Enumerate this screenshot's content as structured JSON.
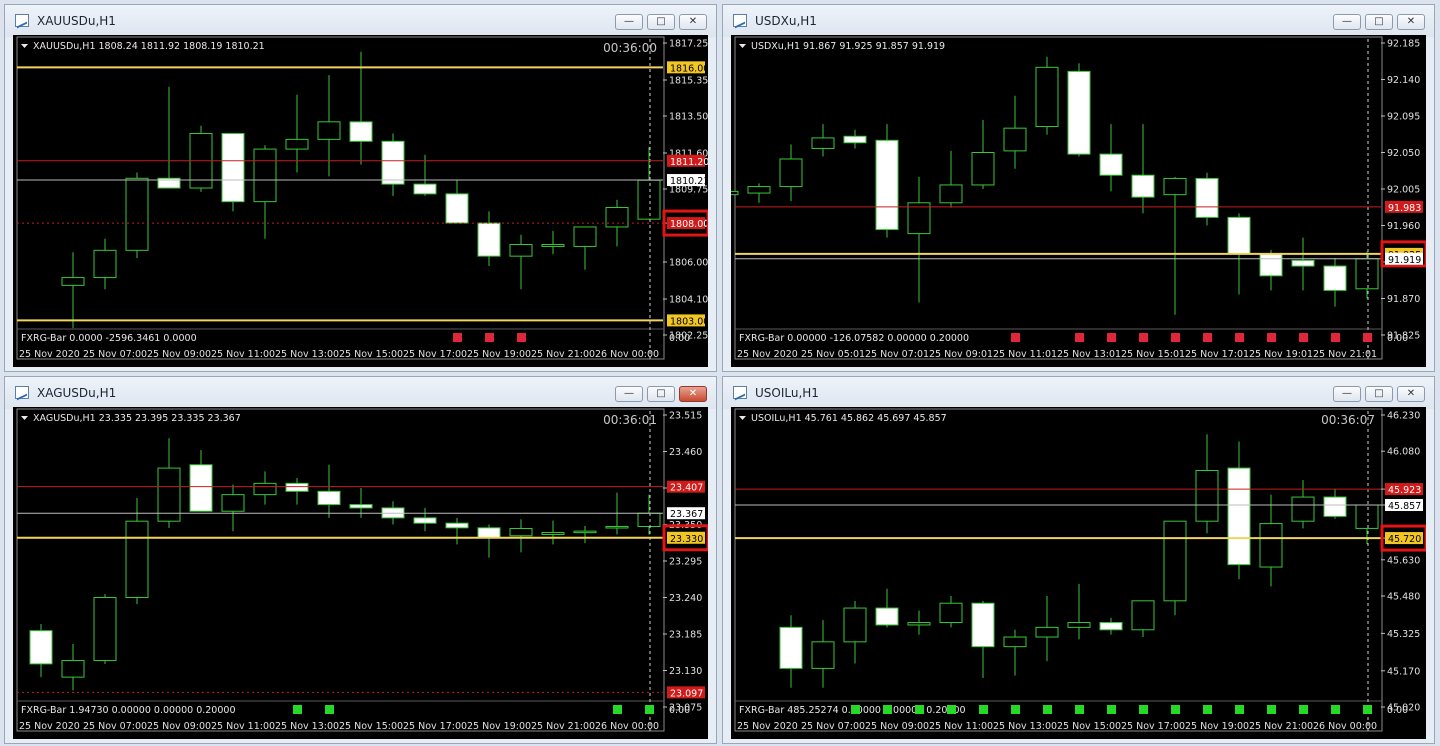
{
  "windows": [
    {
      "title": "XAUUSDu,H1",
      "header": "XAUUSDu,H1  1808.24 1811.92 1808.19 1810.21",
      "timer": "00:36:00",
      "price_labels": [
        "1817.25",
        "1815.35",
        "1813.50",
        "1811.60",
        "1809.75",
        "1808.00",
        "1806.00",
        "1804.10",
        "1802.25"
      ],
      "levels": [
        {
          "value": 1816.0,
          "label": "1816.00",
          "style": "yellow"
        },
        {
          "value": 1811.2,
          "label": "1811.20",
          "style": "red"
        },
        {
          "value": 1810.21,
          "label": "1810.21",
          "style": "white"
        },
        {
          "value": 1808.0,
          "label": "1808.00",
          "style": "red-dashed",
          "highlight": true
        },
        {
          "value": 1803.0,
          "label": "1803.00",
          "style": "yellow"
        }
      ],
      "time_labels": [
        "25 Nov 2020",
        "25 Nov 07:00",
        "25 Nov 09:00",
        "25 Nov 11:00",
        "25 Nov 13:00",
        "25 Nov 15:00",
        "25 Nov 17:00",
        "25 Nov 19:00",
        "25 Nov 21:00",
        "26 Nov 00:00"
      ],
      "indicator": "FXRG-Bar 0.0000 -2596.3461 0.0000",
      "indicator_axis": "0.00",
      "marker_color": "#e0263c",
      "marker_slots": [
        12,
        13,
        14
      ],
      "nbars": 19
    },
    {
      "title": "USDXu,H1",
      "header": "USDXu,H1  91.867 91.925 91.857 91.919",
      "timer": "",
      "price_labels": [
        "92.185",
        "92.140",
        "92.095",
        "92.050",
        "92.005",
        "91.960",
        "91.915",
        "91.870",
        "91.825"
      ],
      "levels": [
        {
          "value": 91.983,
          "label": "91.983",
          "style": "red"
        },
        {
          "value": 91.925,
          "label": "91.925",
          "style": "yellow",
          "highlight": true
        },
        {
          "value": 91.919,
          "label": "91.919",
          "style": "white"
        }
      ],
      "time_labels": [
        "25 Nov 2020",
        "25 Nov 05:01",
        "25 Nov 07:01",
        "25 Nov 09:01",
        "25 Nov 11:01",
        "25 Nov 13:01",
        "25 Nov 15:01",
        "25 Nov 17:01",
        "25 Nov 19:01",
        "25 Nov 21:01"
      ],
      "indicator": "FXRG-Bar 0.00000 -126.07582 0.00000 0.20000",
      "indicator_axis": "0.00",
      "marker_color": "#e0263c",
      "marker_slots": [
        7,
        9,
        10,
        11,
        12,
        13,
        14,
        15,
        16,
        17,
        18
      ],
      "nbars": 19
    },
    {
      "title": "XAGUSDu,H1",
      "header": "XAGUSDu,H1  23.335 23.395 23.335 23.367",
      "timer": "00:36:01",
      "price_labels": [
        "23.515",
        "23.460",
        "23.405",
        "23.350",
        "23.295",
        "23.240",
        "23.185",
        "23.130",
        "23.075"
      ],
      "levels": [
        {
          "value": 23.407,
          "label": "23.407",
          "style": "red"
        },
        {
          "value": 23.367,
          "label": "23.367",
          "style": "white"
        },
        {
          "value": 23.33,
          "label": "23.330",
          "style": "yellow",
          "highlight": true
        },
        {
          "value": 23.097,
          "label": "23.097",
          "style": "red-dashed"
        }
      ],
      "time_labels": [
        "25 Nov 2020",
        "25 Nov 07:00",
        "25 Nov 09:00",
        "25 Nov 11:00",
        "25 Nov 13:00",
        "25 Nov 15:00",
        "25 Nov 17:00",
        "25 Nov 19:00",
        "25 Nov 21:00",
        "26 Nov 00:00"
      ],
      "indicator": "FXRG-Bar 1.94730 0.00000 0.00000 0.20000",
      "indicator_axis": "0.00",
      "marker_color": "#26d926",
      "marker_slots": [
        7,
        8,
        17,
        18
      ],
      "nbars": 19
    },
    {
      "title": "USOILu,H1",
      "header": "USOILu,H1  45.761 45.862 45.697 45.857",
      "timer": "00:36:07",
      "price_labels": [
        "46.230",
        "46.080",
        "45.923",
        "45.857",
        "45.720",
        "45.630",
        "45.480",
        "45.325",
        "45.170",
        "45.020"
      ],
      "levels": [
        {
          "value": 45.923,
          "label": "45.923",
          "style": "red"
        },
        {
          "value": 45.857,
          "label": "45.857",
          "style": "white"
        },
        {
          "value": 45.72,
          "label": "45.720",
          "style": "yellow",
          "highlight": true
        }
      ],
      "time_labels": [
        "25 Nov 2020",
        "25 Nov 07:00",
        "25 Nov 09:00",
        "25 Nov 11:00",
        "25 Nov 13:00",
        "25 Nov 15:00",
        "25 Nov 17:00",
        "25 Nov 19:00",
        "25 Nov 21:00",
        "26 Nov 00:00"
      ],
      "indicator": "FXRG-Bar 485.25274 0.00000 0.00000 0.20000",
      "indicator_axis": "0.00",
      "marker_color": "#26d926",
      "marker_slots": [
        2,
        3,
        4,
        5,
        6,
        7,
        8,
        9,
        10,
        11,
        12,
        13,
        14,
        15,
        16,
        17,
        18
      ],
      "nbars": 19
    }
  ],
  "chart_data": [
    {
      "type": "candlestick",
      "symbol": "XAUUSDu",
      "timeframe": "H1",
      "ylim": [
        1802.25,
        1817.25
      ],
      "ohlc": [
        [
          1804.8,
          1806.5,
          1802.6,
          1805.2
        ],
        [
          1805.2,
          1807.2,
          1804.6,
          1806.6
        ],
        [
          1806.6,
          1810.6,
          1806.2,
          1810.3
        ],
        [
          1810.3,
          1815.0,
          1809.8,
          1809.8
        ],
        [
          1809.8,
          1813.0,
          1809.6,
          1812.6
        ],
        [
          1812.6,
          1812.6,
          1808.6,
          1809.1
        ],
        [
          1809.1,
          1812.0,
          1807.2,
          1811.8
        ],
        [
          1811.8,
          1814.6,
          1810.6,
          1812.3
        ],
        [
          1812.3,
          1815.6,
          1810.4,
          1813.2
        ],
        [
          1813.2,
          1816.8,
          1811.0,
          1812.2
        ],
        [
          1812.2,
          1812.6,
          1809.4,
          1810.0
        ],
        [
          1810.0,
          1811.5,
          1809.4,
          1809.5
        ],
        [
          1809.5,
          1810.2,
          1808.0,
          1808.0
        ],
        [
          1808.0,
          1808.6,
          1805.8,
          1806.3
        ],
        [
          1806.3,
          1807.4,
          1804.6,
          1806.9
        ],
        [
          1806.8,
          1807.6,
          1806.4,
          1806.9
        ],
        [
          1806.8,
          1807.8,
          1805.6,
          1807.8
        ],
        [
          1807.8,
          1809.2,
          1806.8,
          1808.8
        ],
        [
          1808.2,
          1811.9,
          1808.2,
          1810.2
        ]
      ]
    },
    {
      "type": "candlestick",
      "symbol": "USDXu",
      "timeframe": "H1",
      "ylim": [
        91.825,
        92.185
      ],
      "ohlc": [
        [
          91.998,
          92.002,
          91.992,
          92.002
        ],
        [
          92.0,
          92.012,
          91.988,
          92.008
        ],
        [
          92.008,
          92.06,
          91.99,
          92.042
        ],
        [
          92.055,
          92.085,
          92.045,
          92.068
        ],
        [
          92.07,
          92.078,
          92.055,
          92.062
        ],
        [
          92.065,
          92.085,
          91.945,
          91.955
        ],
        [
          91.95,
          92.02,
          91.865,
          91.988
        ],
        [
          91.988,
          92.052,
          91.982,
          92.01
        ],
        [
          92.01,
          92.09,
          92.005,
          92.05
        ],
        [
          92.052,
          92.12,
          92.03,
          92.08
        ],
        [
          92.082,
          92.168,
          92.072,
          92.155
        ],
        [
          92.15,
          92.16,
          92.045,
          92.048
        ],
        [
          92.048,
          92.085,
          92.002,
          92.022
        ],
        [
          92.022,
          92.085,
          91.975,
          91.995
        ],
        [
          91.998,
          92.02,
          91.85,
          92.018
        ],
        [
          92.018,
          92.025,
          91.96,
          91.97
        ],
        [
          91.97,
          91.975,
          91.875,
          91.925
        ],
        [
          91.925,
          91.93,
          91.88,
          91.898
        ],
        [
          91.917,
          91.945,
          91.88,
          91.91
        ],
        [
          91.91,
          91.92,
          91.86,
          91.88
        ],
        [
          91.882,
          91.928,
          91.87,
          91.919
        ]
      ]
    },
    {
      "type": "candlestick",
      "symbol": "XAGUSDu",
      "timeframe": "H1",
      "ylim": [
        23.075,
        23.515
      ],
      "ohlc": [
        [
          23.19,
          23.2,
          23.12,
          23.14
        ],
        [
          23.12,
          23.17,
          23.1,
          23.145
        ],
        [
          23.145,
          23.245,
          23.14,
          23.24
        ],
        [
          23.24,
          23.39,
          23.23,
          23.355
        ],
        [
          23.355,
          23.48,
          23.345,
          23.435
        ],
        [
          23.44,
          23.462,
          23.37,
          23.37
        ],
        [
          23.37,
          23.41,
          23.34,
          23.395
        ],
        [
          23.395,
          23.43,
          23.38,
          23.412
        ],
        [
          23.412,
          23.42,
          23.38,
          23.4
        ],
        [
          23.4,
          23.44,
          23.36,
          23.38
        ],
        [
          23.38,
          23.405,
          23.36,
          23.375
        ],
        [
          23.375,
          23.385,
          23.35,
          23.36
        ],
        [
          23.36,
          23.375,
          23.34,
          23.352
        ],
        [
          23.352,
          23.36,
          23.32,
          23.345
        ],
        [
          23.345,
          23.35,
          23.3,
          23.33
        ],
        [
          23.333,
          23.358,
          23.308,
          23.344
        ],
        [
          23.335,
          23.356,
          23.32,
          23.338
        ],
        [
          23.338,
          23.348,
          23.322,
          23.34
        ],
        [
          23.345,
          23.398,
          23.335,
          23.347
        ],
        [
          23.347,
          23.395,
          23.335,
          23.367
        ]
      ]
    },
    {
      "type": "candlestick",
      "symbol": "USOILu",
      "timeframe": "H1",
      "ylim": [
        45.02,
        46.23
      ],
      "ohlc": [
        [
          45.35,
          45.4,
          45.1,
          45.18
        ],
        [
          45.18,
          45.38,
          45.1,
          45.29
        ],
        [
          45.29,
          45.46,
          45.2,
          45.43
        ],
        [
          45.43,
          45.51,
          45.35,
          45.36
        ],
        [
          45.36,
          45.42,
          45.32,
          45.37
        ],
        [
          45.37,
          45.48,
          45.35,
          45.45
        ],
        [
          45.45,
          45.46,
          45.14,
          45.27
        ],
        [
          45.27,
          45.34,
          45.15,
          45.31
        ],
        [
          45.31,
          45.48,
          45.21,
          45.35
        ],
        [
          45.35,
          45.53,
          45.3,
          45.37
        ],
        [
          45.37,
          45.39,
          45.32,
          45.34
        ],
        [
          45.34,
          45.46,
          45.31,
          45.46
        ],
        [
          45.46,
          45.78,
          45.4,
          45.79
        ],
        [
          45.79,
          46.15,
          45.74,
          46.0
        ],
        [
          46.01,
          46.12,
          45.55,
          45.61
        ],
        [
          45.6,
          45.9,
          45.52,
          45.78
        ],
        [
          45.79,
          45.96,
          45.76,
          45.89
        ],
        [
          45.89,
          45.925,
          45.8,
          45.81
        ],
        [
          45.76,
          45.86,
          45.695,
          45.857
        ]
      ]
    }
  ]
}
